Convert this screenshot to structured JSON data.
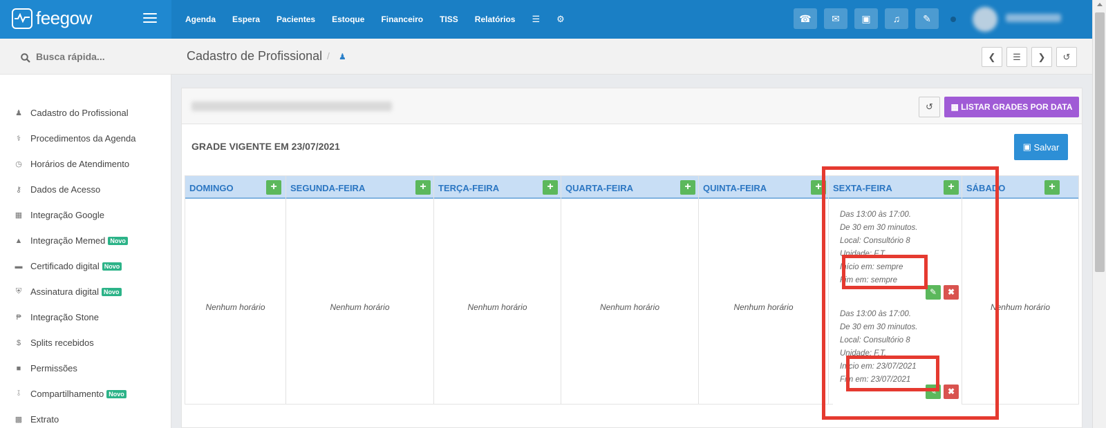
{
  "brand": {
    "name": "feegow"
  },
  "nav": {
    "items": [
      "Agenda",
      "Espera",
      "Pacientes",
      "Estoque",
      "Financeiro",
      "TISS",
      "Relatórios"
    ],
    "icons": [
      "database-icon",
      "gear-icon"
    ]
  },
  "top_actions": [
    "phone-icon",
    "inbox-icon",
    "card-icon",
    "bell-icon",
    "chat-icon"
  ],
  "search": {
    "placeholder": "Busca rápida..."
  },
  "sidebar": {
    "items": [
      {
        "label": "Cadastro do Profissional",
        "icon": "user-md-icon",
        "badge": ""
      },
      {
        "label": "Procedimentos da Agenda",
        "icon": "stethoscope-icon",
        "badge": ""
      },
      {
        "label": "Horários de Atendimento",
        "icon": "clock-icon",
        "badge": ""
      },
      {
        "label": "Dados de Acesso",
        "icon": "key-icon",
        "badge": ""
      },
      {
        "label": "Integração Google",
        "icon": "calendar-icon",
        "badge": ""
      },
      {
        "label": "Integração Memed",
        "icon": "flask-icon",
        "badge": "Novo"
      },
      {
        "label": "Certificado digital",
        "icon": "credit-card-icon",
        "badge": "Novo"
      },
      {
        "label": "Assinatura digital",
        "icon": "shield-icon",
        "badge": "Novo"
      },
      {
        "label": "Integração Stone",
        "icon": "stone-icon",
        "badge": ""
      },
      {
        "label": "Splits recebidos",
        "icon": "dollar-icon",
        "badge": ""
      },
      {
        "label": "Permissões",
        "icon": "lock-icon",
        "badge": ""
      },
      {
        "label": "Compartilhamento",
        "icon": "share-icon",
        "badge": "Novo"
      },
      {
        "label": "Extrato",
        "icon": "money-icon",
        "badge": ""
      }
    ]
  },
  "page": {
    "title": "Cadastro de Profissional",
    "separator": "/"
  },
  "panel": {
    "list_button": "LISTAR GRADES POR DATA",
    "grade_title": "GRADE VIGENTE EM 23/07/2021",
    "save_button": "Salvar"
  },
  "schedule": {
    "empty_text": "Nenhum horário",
    "days": [
      "DOMINGO",
      "SEGUNDA-FEIRA",
      "TERÇA-FEIRA",
      "QUARTA-FEIRA",
      "QUINTA-FEIRA",
      "SEXTA-FEIRA",
      "SÁBADO"
    ],
    "friday_slots": [
      {
        "time": "Das 13:00 às 17:00.",
        "interval": "De 30 em 30 minutos.",
        "local": "Local: Consultório 8",
        "unit": "Unidade: F.T.",
        "start": "Início em: sempre",
        "end": "Fim em: sempre"
      },
      {
        "time": "Das 13:00 às 17:00.",
        "interval": "De 30 em 30 minutos.",
        "local": "Local: Consultório 8",
        "unit": "Unidade: F.T.",
        "start": "Início em: 23/07/2021",
        "end": "Fim em: 23/07/2021"
      }
    ]
  },
  "colors": {
    "topbar": "#1a7fc5",
    "accent_purple": "#a05bd6",
    "save_blue": "#2d8fd6",
    "add_green": "#5cb85c",
    "delete_red": "#d9534f",
    "annotation_red": "#e53a30"
  }
}
